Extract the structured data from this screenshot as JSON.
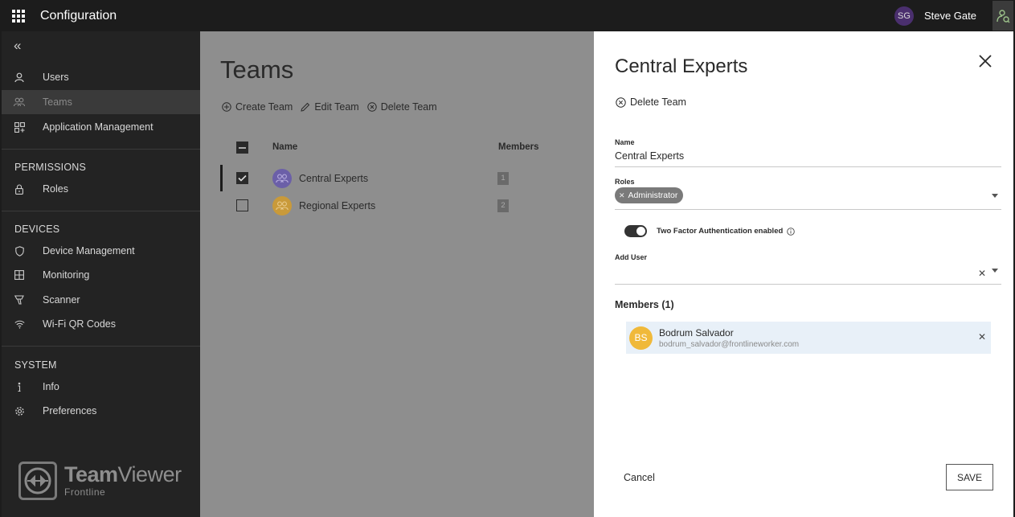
{
  "topbar": {
    "app_title": "Configuration",
    "user_initials": "SG",
    "user_name": "Steve Gate"
  },
  "sidebar": {
    "items": [
      {
        "label": "Users",
        "icon": "user-icon"
      },
      {
        "label": "Teams",
        "icon": "teams-icon",
        "active": true
      },
      {
        "label": "Application Management",
        "icon": "apps-icon"
      }
    ],
    "sections": [
      {
        "title": "PERMISSIONS",
        "items": [
          {
            "label": "Roles",
            "icon": "lock-icon"
          }
        ]
      },
      {
        "title": "DEVICES",
        "items": [
          {
            "label": "Device Management",
            "icon": "shield-icon"
          },
          {
            "label": "Monitoring",
            "icon": "grid-icon"
          },
          {
            "label": "Scanner",
            "icon": "scanner-icon"
          },
          {
            "label": "Wi-Fi QR Codes",
            "icon": "wifi-icon"
          }
        ]
      },
      {
        "title": "SYSTEM",
        "items": [
          {
            "label": "Info",
            "icon": "info-icon"
          },
          {
            "label": "Preferences",
            "icon": "gear-icon"
          }
        ]
      }
    ],
    "logo": {
      "brand_light": "Team",
      "brand_bold": "Viewer",
      "sub": "Frontline"
    }
  },
  "main": {
    "title": "Teams",
    "toolbar": {
      "create": "Create Team",
      "edit": "Edit Team",
      "delete": "Delete Team"
    },
    "table": {
      "columns": [
        "Name",
        "Members"
      ],
      "rows": [
        {
          "name": "Central Experts",
          "members": "1",
          "checked": true,
          "avatar_color": "#6b5fa8"
        },
        {
          "name": "Regional Experts",
          "members": "2",
          "checked": false,
          "avatar_color": "#c99a3a"
        }
      ]
    }
  },
  "panel": {
    "title": "Central Experts",
    "delete_label": "Delete Team",
    "name_label": "Name",
    "name_value": "Central Experts",
    "roles_label": "Roles",
    "role_chip": "Administrator",
    "tfa_label": "Two Factor Authentication enabled",
    "tfa_enabled": true,
    "add_user_label": "Add User",
    "add_user_value": "",
    "members_title": "Members (1)",
    "members": [
      {
        "initials": "BS",
        "name": "Bodrum Salvador",
        "email": "bodrum_salvador@frontlineworker.com"
      }
    ],
    "cancel_label": "Cancel",
    "save_label": "SAVE"
  },
  "colors": {
    "topbar_bg": "#1c1c1c",
    "sidebar_bg": "#232323",
    "overlay_bg": "#8e8e8e",
    "chip_bg": "#7a7a7a",
    "member_card_bg": "#e8f0f8",
    "member_avatar_bg": "#f0b93a"
  }
}
